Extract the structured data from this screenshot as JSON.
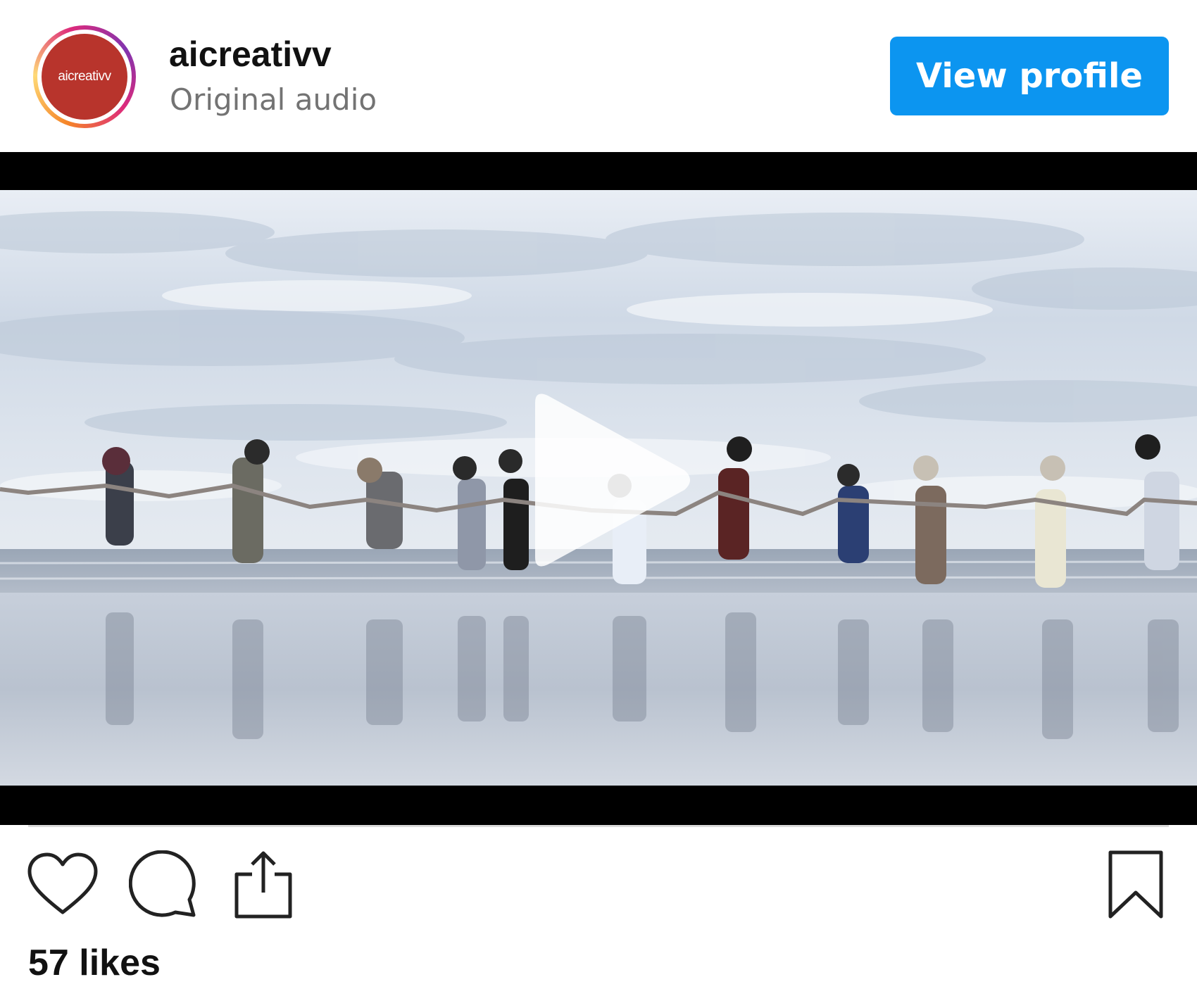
{
  "post": {
    "avatar_text": "aicreativv",
    "username": "aicreativv",
    "audio_label": "Original audio",
    "view_profile_label": "View profile",
    "likes_text": "57 likes"
  },
  "colors": {
    "button_blue": "#0c95f0",
    "avatar_red": "#b8342c",
    "secondary_text": "#737373"
  },
  "icons": {
    "like": "heart-icon",
    "comment": "comment-icon",
    "share": "share-icon",
    "save": "bookmark-icon",
    "play": "play-icon"
  }
}
